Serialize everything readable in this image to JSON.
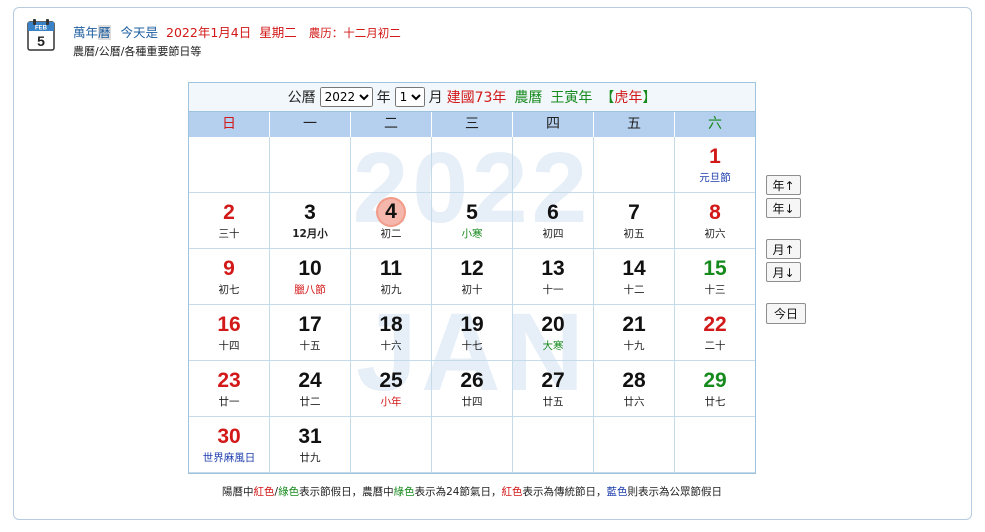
{
  "header": {
    "icon_month": "FEB",
    "icon_day": "5",
    "app_name_a": "萬年",
    "app_name_b": "曆",
    "today_label": "今天是",
    "today_date": "2022年1月4日",
    "today_weekday": "星期二",
    "lunar_label": "農历：十二月初二",
    "subtitle": "農曆/公曆/各種重要節日等"
  },
  "calendar": {
    "label_gregorian": "公曆",
    "year_value": "2022",
    "label_year": "年",
    "month_value": "1",
    "label_month": "月",
    "roc_year": "建國73年",
    "lunar_cal": "農曆",
    "ganzhi": "王寅年",
    "zodiac_open": "【",
    "zodiac": "虎年",
    "zodiac_close": "】",
    "watermark_year": "2022",
    "watermark_month": "JAN",
    "weekdays": [
      "日",
      "一",
      "二",
      "三",
      "四",
      "五",
      "六"
    ],
    "weeks": [
      [
        null,
        null,
        null,
        null,
        null,
        null,
        {
          "d": "1",
          "dc": "red",
          "l": "元旦節",
          "lc": "blue"
        }
      ],
      [
        {
          "d": "2",
          "dc": "red",
          "l": "三十"
        },
        {
          "d": "3",
          "l": "12月小",
          "lc": "bold"
        },
        {
          "d": "4",
          "l": "初二",
          "today": true
        },
        {
          "d": "5",
          "l": "小寒",
          "lc": "green"
        },
        {
          "d": "6",
          "l": "初四"
        },
        {
          "d": "7",
          "l": "初五"
        },
        {
          "d": "8",
          "dc": "red",
          "l": "初六"
        }
      ],
      [
        {
          "d": "9",
          "dc": "red",
          "l": "初七"
        },
        {
          "d": "10",
          "l": "臘八節",
          "lc": "red"
        },
        {
          "d": "11",
          "l": "初九"
        },
        {
          "d": "12",
          "l": "初十"
        },
        {
          "d": "13",
          "l": "十一"
        },
        {
          "d": "14",
          "l": "十二"
        },
        {
          "d": "15",
          "dc": "green",
          "l": "十三"
        }
      ],
      [
        {
          "d": "16",
          "dc": "red",
          "l": "十四"
        },
        {
          "d": "17",
          "l": "十五"
        },
        {
          "d": "18",
          "l": "十六"
        },
        {
          "d": "19",
          "l": "十七"
        },
        {
          "d": "20",
          "l": "大寒",
          "lc": "green"
        },
        {
          "d": "21",
          "l": "十九"
        },
        {
          "d": "22",
          "dc": "red",
          "l": "二十"
        }
      ],
      [
        {
          "d": "23",
          "dc": "red",
          "l": "廿一"
        },
        {
          "d": "24",
          "l": "廿二"
        },
        {
          "d": "25",
          "l": "小年",
          "lc": "red"
        },
        {
          "d": "26",
          "l": "廿四"
        },
        {
          "d": "27",
          "l": "廿五"
        },
        {
          "d": "28",
          "l": "廿六"
        },
        {
          "d": "29",
          "dc": "green",
          "l": "廿七"
        }
      ],
      [
        {
          "d": "30",
          "dc": "red",
          "l": "世界麻風日",
          "lc": "blue"
        },
        {
          "d": "31",
          "l": "廿九"
        },
        null,
        null,
        null,
        null,
        null
      ]
    ]
  },
  "side_buttons": {
    "year_up": "年↑",
    "year_down": "年↓",
    "month_up": "月↑",
    "month_down": "月↓",
    "today": "今日"
  },
  "legend": {
    "p1": "陽曆中",
    "red1": "紅色",
    "slash": "/",
    "green1": "綠色",
    "p2": "表示節假日，農曆中",
    "green2": "綠色",
    "p3": "表示為24節氣日，",
    "red2": "紅色",
    "p4": "表示為傳統節日，",
    "blue1": "藍色",
    "p5": "則表示為公眾節假日"
  },
  "colors": {
    "holiday_red": "#d21818",
    "solar_term_green": "#178a1e",
    "public_blue": "#1f3fae",
    "weekday_header": "#b5d0ee",
    "today_highlight": "#f5b7ab"
  }
}
